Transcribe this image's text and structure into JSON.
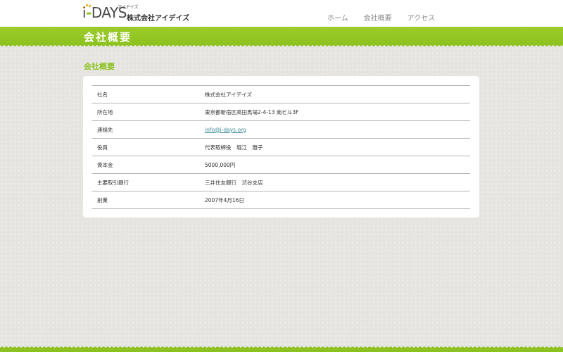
{
  "header": {
    "logo": {
      "mark_letter": "i",
      "mark_rest": "DAYS",
      "ruby": "アイデイズ",
      "company": "株式会社アイデイズ"
    },
    "nav": [
      {
        "label": "ホーム"
      },
      {
        "label": "会社概要"
      },
      {
        "label": "アクセス"
      }
    ]
  },
  "banner": {
    "title": "会社概要"
  },
  "main": {
    "heading": "会社概要",
    "rows": [
      {
        "label": "社名",
        "value": "株式会社アイデイズ"
      },
      {
        "label": "所在地",
        "value": "東京都新宿区高田馬場2-4-13 南ビル3F"
      },
      {
        "label": "連絡先",
        "value": "info@i-days.org"
      },
      {
        "label": "役員",
        "value": "代表取締役　堀江　雅子"
      },
      {
        "label": "資本金",
        "value": "5000,000円"
      },
      {
        "label": "主要取引銀行",
        "value": "三井住友銀行　渋谷支店"
      },
      {
        "label": "創業",
        "value": "2007年4月16日"
      }
    ]
  },
  "colors": {
    "accent_green": "#8cc21f",
    "link": "#3a8a95",
    "logo_dot": "#f2a900"
  }
}
